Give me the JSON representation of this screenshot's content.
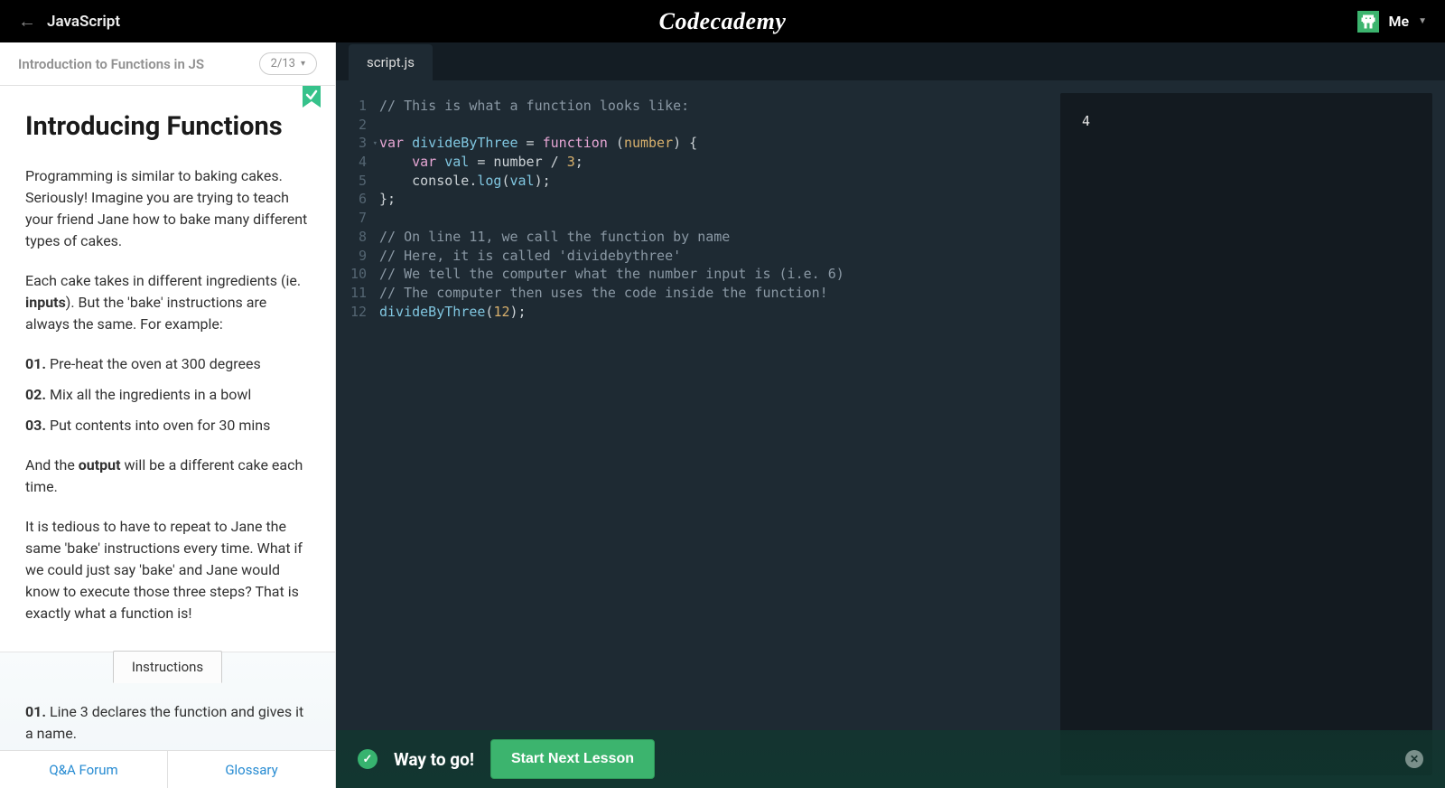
{
  "topbar": {
    "course": "JavaScript",
    "logo": "Codecademy",
    "me": "Me"
  },
  "sidebar": {
    "unit": "Introduction to Functions in JS",
    "progress": "2/13",
    "lesson_title": "Introducing Functions",
    "p1": "Programming is similar to baking cakes. Seriously! Imagine you are trying to teach your friend Jane how to bake many different types of cakes.",
    "p2a": "Each cake takes in different ingredients (ie. ",
    "p2b_bold": "inputs",
    "p2c": "). But the 'bake' instructions are always the same. For example:",
    "steps": [
      {
        "n": "01.",
        "t": "Pre-heat the oven at 300 degrees"
      },
      {
        "n": "02.",
        "t": "Mix all the ingredients in a bowl"
      },
      {
        "n": "03.",
        "t": "Put contents into oven for 30 mins"
      }
    ],
    "p3a": "And the ",
    "p3b_bold": "output",
    "p3c": " will be a different cake each time.",
    "p4": "It is tedious to have to repeat to Jane the same 'bake' instructions every time. What if we could just say 'bake' and Jane would know to execute those three steps? That is exactly what a function is!",
    "instructions_label": "Instructions",
    "instr1_n": "01.",
    "instr1_t": " Line 3 declares the function and gives it a name.",
    "footer": {
      "qa": "Q&A Forum",
      "glossary": "Glossary"
    }
  },
  "editor": {
    "tab": "script.js",
    "lines": [
      {
        "type": "comment",
        "raw": "// This is what a function looks like:"
      },
      {
        "type": "blank",
        "raw": ""
      },
      {
        "type": "code",
        "tokens": [
          [
            "kw",
            "var "
          ],
          [
            "var",
            "divideByThree"
          ],
          [
            "punc",
            " = "
          ],
          [
            "func",
            "function"
          ],
          [
            "punc",
            " ("
          ],
          [
            "param",
            "number"
          ],
          [
            "punc",
            ") {"
          ]
        ]
      },
      {
        "type": "code",
        "tokens": [
          [
            "punc",
            "    "
          ],
          [
            "kw",
            "var "
          ],
          [
            "var",
            "val"
          ],
          [
            "punc",
            " = number / "
          ],
          [
            "num",
            "3"
          ],
          [
            "punc",
            ";"
          ]
        ]
      },
      {
        "type": "code",
        "tokens": [
          [
            "punc",
            "    console."
          ],
          [
            "call",
            "log"
          ],
          [
            "punc",
            "("
          ],
          [
            "var",
            "val"
          ],
          [
            "punc",
            ");"
          ]
        ]
      },
      {
        "type": "code",
        "tokens": [
          [
            "punc",
            "};"
          ]
        ]
      },
      {
        "type": "blank",
        "raw": ""
      },
      {
        "type": "comment",
        "raw": "// On line 11, we call the function by name"
      },
      {
        "type": "comment",
        "raw": "// Here, it is called 'dividebythree'"
      },
      {
        "type": "comment",
        "raw": "// We tell the computer what the number input is (i.e. 6)"
      },
      {
        "type": "comment",
        "raw": "// The computer then uses the code inside the function!"
      },
      {
        "type": "code",
        "tokens": [
          [
            "var",
            "divideByThree"
          ],
          [
            "punc",
            "("
          ],
          [
            "num",
            "12"
          ],
          [
            "punc",
            ");"
          ]
        ]
      }
    ]
  },
  "output": "4",
  "bottombar": {
    "message": "Way to go!",
    "button": "Start Next Lesson"
  }
}
